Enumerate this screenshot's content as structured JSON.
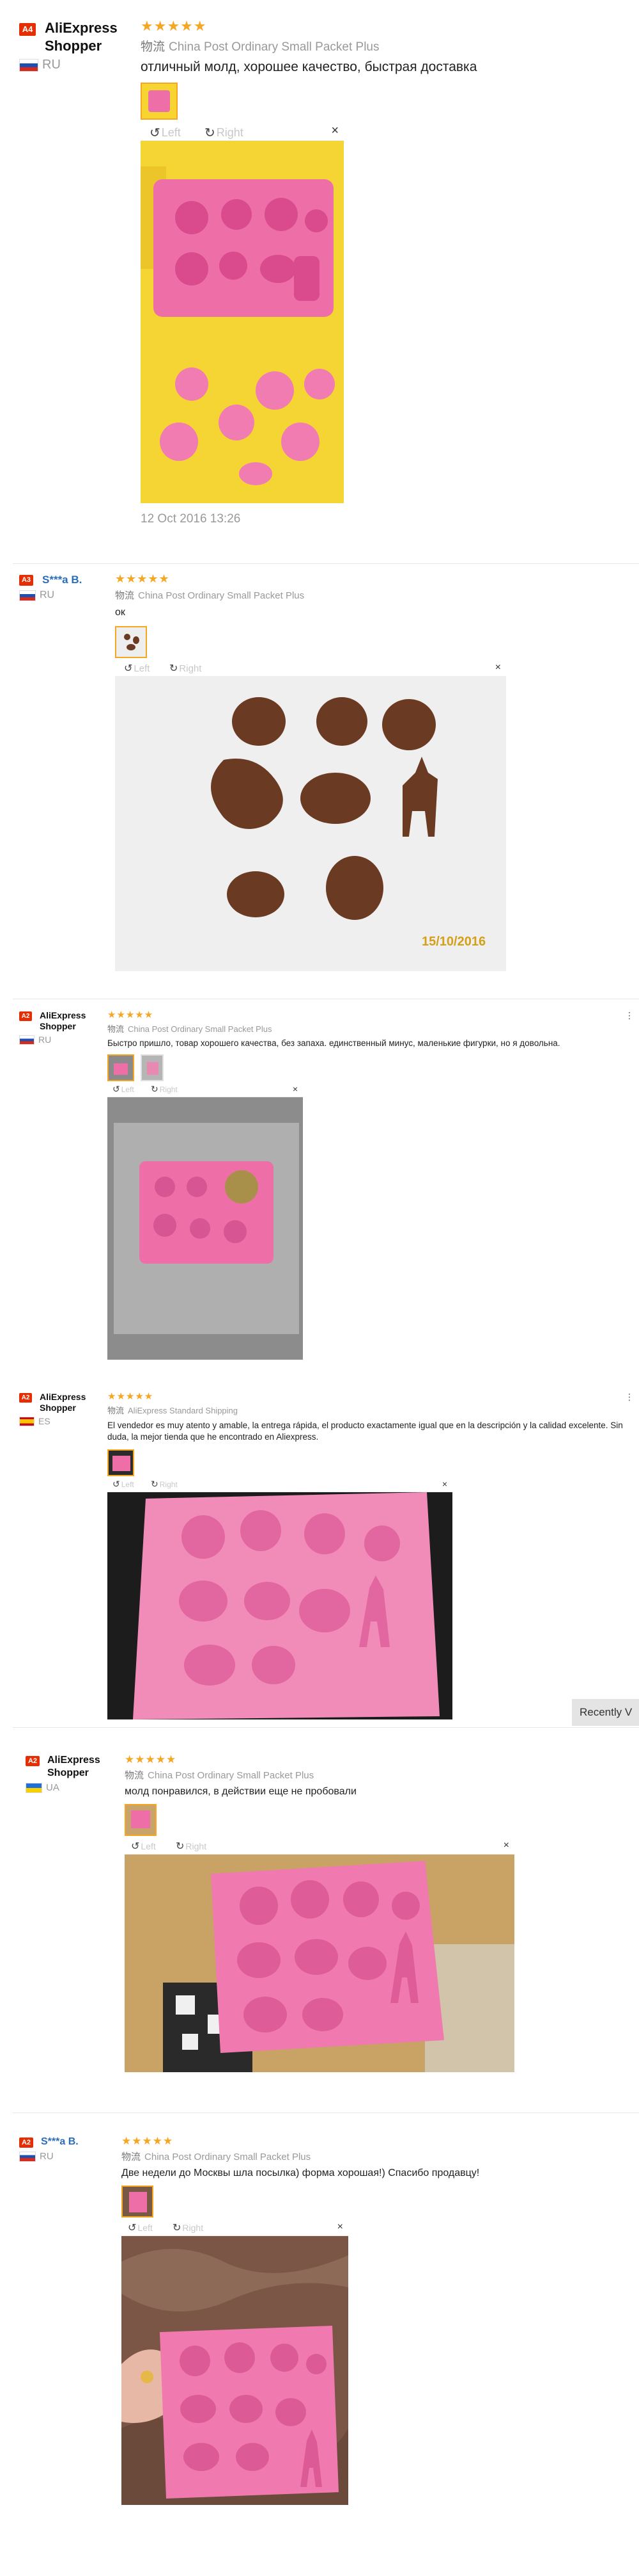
{
  "reviews": [
    {
      "badge": "A4",
      "user": "AliExpress Shopper",
      "country": "RU",
      "stars": "★★★★★",
      "ship_zh": "物流",
      "shipping": "China Post Ordinary Small Packet Plus",
      "text": "отличный молд, хорошее качество, быстрая доставка",
      "date": "12 Oct 2016 13:26",
      "viewer": {
        "left": "Left",
        "right": "Right",
        "close": "×"
      }
    },
    {
      "badge": "A3",
      "user": "S***a B.",
      "country": "RU",
      "stars": "★★★★★",
      "ship_zh": "物流",
      "shipping": "China Post Ordinary Small Packet Plus",
      "text": "ок",
      "photo_stamp": "15/10/2016",
      "viewer": {
        "left": "Left",
        "right": "Right",
        "close": "×"
      }
    },
    {
      "badge": "A2",
      "user": "AliExpress Shopper",
      "country": "RU",
      "stars": "★★★★★",
      "ship_zh": "物流",
      "shipping": "China Post Ordinary Small Packet Plus",
      "text": "Быстро пришло, товар хорошего качества, без запаха. единственный минус, маленькие фигурки, но я довольна.",
      "viewer": {
        "left": "Left",
        "right": "Right",
        "close": "×"
      }
    },
    {
      "badge": "A2",
      "user": "AliExpress Shopper",
      "country": "ES",
      "stars": "★★★★★",
      "ship_zh": "物流",
      "shipping": "AliExpress Standard Shipping",
      "text": "El vendedor es muy atento y amable, la entrega rápida, el producto exactamente igual que en la descripción y la calidad excelente. Sin duda, la mejor tienda que he encontrado en Aliexpress.",
      "viewer": {
        "left": "Left",
        "right": "Right",
        "close": "×"
      }
    },
    {
      "badge": "A2",
      "user": "AliExpress Shopper",
      "country": "UA",
      "stars": "★★★★★",
      "ship_zh": "物流",
      "shipping": "China Post Ordinary Small Packet Plus",
      "text": "молд понравился, в действии еще не пробовали",
      "viewer": {
        "left": "Left",
        "right": "Right",
        "close": "×"
      }
    },
    {
      "badge": "A2",
      "user": "S***a B.",
      "country": "RU",
      "stars": "★★★★★",
      "ship_zh": "物流",
      "shipping": "China Post Ordinary Small Packet Plus",
      "text": "Две недели до Москвы шла посылка) форма хорошая!) Спасибо продавцу!",
      "viewer": {
        "left": "Left",
        "right": "Right",
        "close": "×"
      }
    }
  ],
  "recently_viewed": "Recently V",
  "colors": {
    "star": "#f5a623",
    "badge": "#e62e04",
    "mold_pink": "#ee6fa8",
    "chocolate": "#6b3a22"
  }
}
